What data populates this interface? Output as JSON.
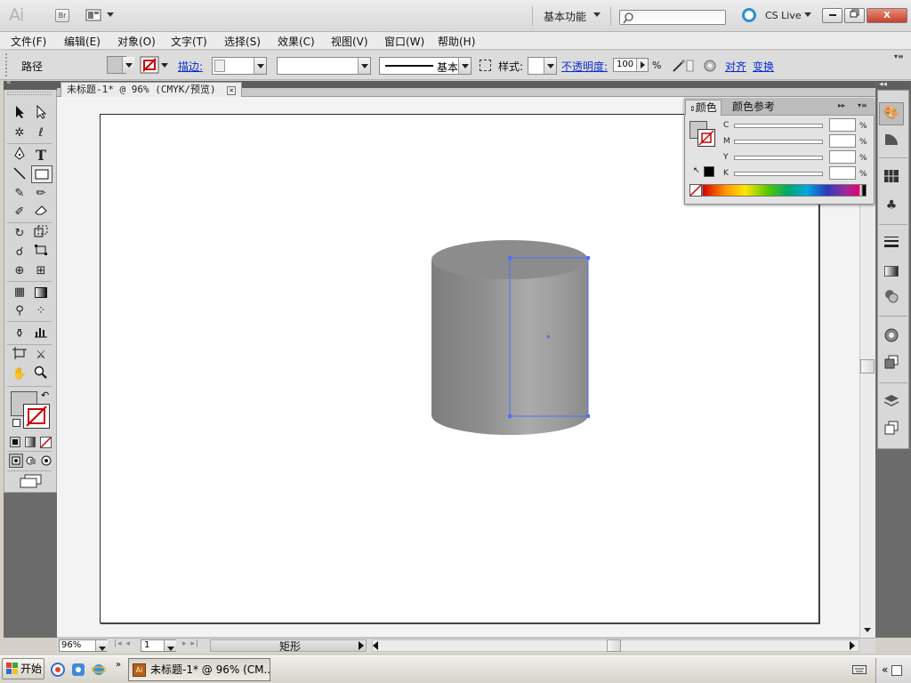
{
  "titlebar": {
    "app_logo": "Ai",
    "bridge_label": "Br",
    "workspace": "基本功能",
    "cs_live": "CS Live",
    "close_label": "X"
  },
  "menu": [
    "文件(F)",
    "编辑(E)",
    "对象(O)",
    "文字(T)",
    "选择(S)",
    "效果(C)",
    "视图(V)",
    "窗口(W)",
    "帮助(H)"
  ],
  "control": {
    "selection_label": "路径",
    "stroke_link": "描边:",
    "stroke_profile": "基本",
    "style_label": "样式:",
    "opacity_link": "不透明度:",
    "opacity_value": "100",
    "opacity_unit": "%",
    "align_link": "对齐",
    "transform_link": "变换"
  },
  "document": {
    "tab_label": "未标题-1* @ 96% (CMYK/预览)"
  },
  "status": {
    "zoom": "96%",
    "page": "1",
    "tool_name": "矩形"
  },
  "color_panel": {
    "tab_color": "颜色",
    "tab_guide": "颜色参考",
    "channels": [
      "C",
      "M",
      "Y",
      "K"
    ],
    "percent": "%"
  },
  "taskbar": {
    "start": "开始",
    "task": "未标题-1* @ 96% (CM..."
  },
  "colors": {
    "selection": "#4f6fff",
    "cylinder_dark": "#7a7a7a",
    "cylinder_light": "#a8a8a8"
  }
}
